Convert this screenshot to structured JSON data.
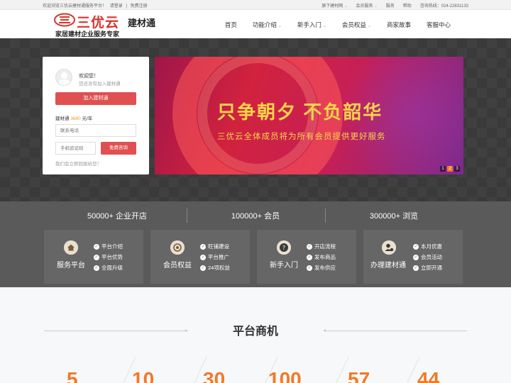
{
  "topbar": {
    "welcome": "欢迎浏览三优云建材通服务平台！",
    "login": "请登录",
    "sep": "|",
    "register": "免费注册",
    "links": [
      "旗下建材网",
      "会员服务",
      "服务",
      "帮助"
    ],
    "hotline": "咨询热线：024-22831133"
  },
  "header": {
    "brand": "三优云",
    "product": "建材通",
    "slogan": "家居建材企业服务专家",
    "nav": [
      "首页",
      "功能介绍",
      "新手入门",
      "会员权益",
      "商家故事",
      "客服中心"
    ]
  },
  "login_box": {
    "greeting": "欢迎您！",
    "subtitle": "您还没有加入建材通",
    "join_button": "加入建材通",
    "price_label": "建材通",
    "price_value": "3680",
    "price_unit": "元/年",
    "phone_placeholder": "联系电话",
    "code_placeholder": "手机验证码",
    "consult_button": "免费咨询",
    "note": "我们会立即回拨给您！"
  },
  "banner": {
    "title": "只争朝夕 不负韶华",
    "subtitle": "三优云全体成员将为所有会员提供更好服务",
    "pages": [
      "1",
      "2",
      "3"
    ],
    "active_page": "2"
  },
  "stats": [
    "50000+ 企业开店",
    "100000+ 会员",
    "300000+ 浏览"
  ],
  "cards": [
    {
      "title": "服务平台",
      "icon": "home-icon",
      "items": [
        "平台介绍",
        "平台优势",
        "全面升级"
      ]
    },
    {
      "title": "会员权益",
      "icon": "target-icon",
      "items": [
        "旺铺建设",
        "平台推广",
        "24项权益"
      ]
    },
    {
      "title": "新手入门",
      "icon": "help-icon",
      "items": [
        "开店流程",
        "发布商品",
        "发布供应"
      ]
    },
    {
      "title": "办理建材通",
      "icon": "user-gear-icon",
      "items": [
        "本月优惠",
        "会员活动",
        "立即开通"
      ]
    }
  ],
  "section": {
    "title": "平台商机",
    "metrics": [
      "5",
      "10",
      "30",
      "100",
      "57",
      "44"
    ]
  },
  "colors": {
    "accent": "#e05050",
    "brand_red": "#d9352c",
    "orange": "#ef7a2a",
    "banner_text": "#f7d44a"
  }
}
